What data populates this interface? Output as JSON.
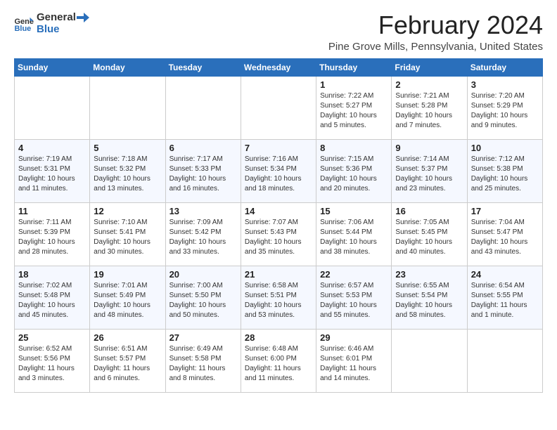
{
  "header": {
    "logo_general": "General",
    "logo_blue": "Blue",
    "month_title": "February 2024",
    "location": "Pine Grove Mills, Pennsylvania, United States"
  },
  "days_of_week": [
    "Sunday",
    "Monday",
    "Tuesday",
    "Wednesday",
    "Thursday",
    "Friday",
    "Saturday"
  ],
  "weeks": [
    [
      {
        "day": "",
        "info": ""
      },
      {
        "day": "",
        "info": ""
      },
      {
        "day": "",
        "info": ""
      },
      {
        "day": "",
        "info": ""
      },
      {
        "day": "1",
        "info": "Sunrise: 7:22 AM\nSunset: 5:27 PM\nDaylight: 10 hours\nand 5 minutes."
      },
      {
        "day": "2",
        "info": "Sunrise: 7:21 AM\nSunset: 5:28 PM\nDaylight: 10 hours\nand 7 minutes."
      },
      {
        "day": "3",
        "info": "Sunrise: 7:20 AM\nSunset: 5:29 PM\nDaylight: 10 hours\nand 9 minutes."
      }
    ],
    [
      {
        "day": "4",
        "info": "Sunrise: 7:19 AM\nSunset: 5:31 PM\nDaylight: 10 hours\nand 11 minutes."
      },
      {
        "day": "5",
        "info": "Sunrise: 7:18 AM\nSunset: 5:32 PM\nDaylight: 10 hours\nand 13 minutes."
      },
      {
        "day": "6",
        "info": "Sunrise: 7:17 AM\nSunset: 5:33 PM\nDaylight: 10 hours\nand 16 minutes."
      },
      {
        "day": "7",
        "info": "Sunrise: 7:16 AM\nSunset: 5:34 PM\nDaylight: 10 hours\nand 18 minutes."
      },
      {
        "day": "8",
        "info": "Sunrise: 7:15 AM\nSunset: 5:36 PM\nDaylight: 10 hours\nand 20 minutes."
      },
      {
        "day": "9",
        "info": "Sunrise: 7:14 AM\nSunset: 5:37 PM\nDaylight: 10 hours\nand 23 minutes."
      },
      {
        "day": "10",
        "info": "Sunrise: 7:12 AM\nSunset: 5:38 PM\nDaylight: 10 hours\nand 25 minutes."
      }
    ],
    [
      {
        "day": "11",
        "info": "Sunrise: 7:11 AM\nSunset: 5:39 PM\nDaylight: 10 hours\nand 28 minutes."
      },
      {
        "day": "12",
        "info": "Sunrise: 7:10 AM\nSunset: 5:41 PM\nDaylight: 10 hours\nand 30 minutes."
      },
      {
        "day": "13",
        "info": "Sunrise: 7:09 AM\nSunset: 5:42 PM\nDaylight: 10 hours\nand 33 minutes."
      },
      {
        "day": "14",
        "info": "Sunrise: 7:07 AM\nSunset: 5:43 PM\nDaylight: 10 hours\nand 35 minutes."
      },
      {
        "day": "15",
        "info": "Sunrise: 7:06 AM\nSunset: 5:44 PM\nDaylight: 10 hours\nand 38 minutes."
      },
      {
        "day": "16",
        "info": "Sunrise: 7:05 AM\nSunset: 5:45 PM\nDaylight: 10 hours\nand 40 minutes."
      },
      {
        "day": "17",
        "info": "Sunrise: 7:04 AM\nSunset: 5:47 PM\nDaylight: 10 hours\nand 43 minutes."
      }
    ],
    [
      {
        "day": "18",
        "info": "Sunrise: 7:02 AM\nSunset: 5:48 PM\nDaylight: 10 hours\nand 45 minutes."
      },
      {
        "day": "19",
        "info": "Sunrise: 7:01 AM\nSunset: 5:49 PM\nDaylight: 10 hours\nand 48 minutes."
      },
      {
        "day": "20",
        "info": "Sunrise: 7:00 AM\nSunset: 5:50 PM\nDaylight: 10 hours\nand 50 minutes."
      },
      {
        "day": "21",
        "info": "Sunrise: 6:58 AM\nSunset: 5:51 PM\nDaylight: 10 hours\nand 53 minutes."
      },
      {
        "day": "22",
        "info": "Sunrise: 6:57 AM\nSunset: 5:53 PM\nDaylight: 10 hours\nand 55 minutes."
      },
      {
        "day": "23",
        "info": "Sunrise: 6:55 AM\nSunset: 5:54 PM\nDaylight: 10 hours\nand 58 minutes."
      },
      {
        "day": "24",
        "info": "Sunrise: 6:54 AM\nSunset: 5:55 PM\nDaylight: 11 hours\nand 1 minute."
      }
    ],
    [
      {
        "day": "25",
        "info": "Sunrise: 6:52 AM\nSunset: 5:56 PM\nDaylight: 11 hours\nand 3 minutes."
      },
      {
        "day": "26",
        "info": "Sunrise: 6:51 AM\nSunset: 5:57 PM\nDaylight: 11 hours\nand 6 minutes."
      },
      {
        "day": "27",
        "info": "Sunrise: 6:49 AM\nSunset: 5:58 PM\nDaylight: 11 hours\nand 8 minutes."
      },
      {
        "day": "28",
        "info": "Sunrise: 6:48 AM\nSunset: 6:00 PM\nDaylight: 11 hours\nand 11 minutes."
      },
      {
        "day": "29",
        "info": "Sunrise: 6:46 AM\nSunset: 6:01 PM\nDaylight: 11 hours\nand 14 minutes."
      },
      {
        "day": "",
        "info": ""
      },
      {
        "day": "",
        "info": ""
      }
    ]
  ]
}
